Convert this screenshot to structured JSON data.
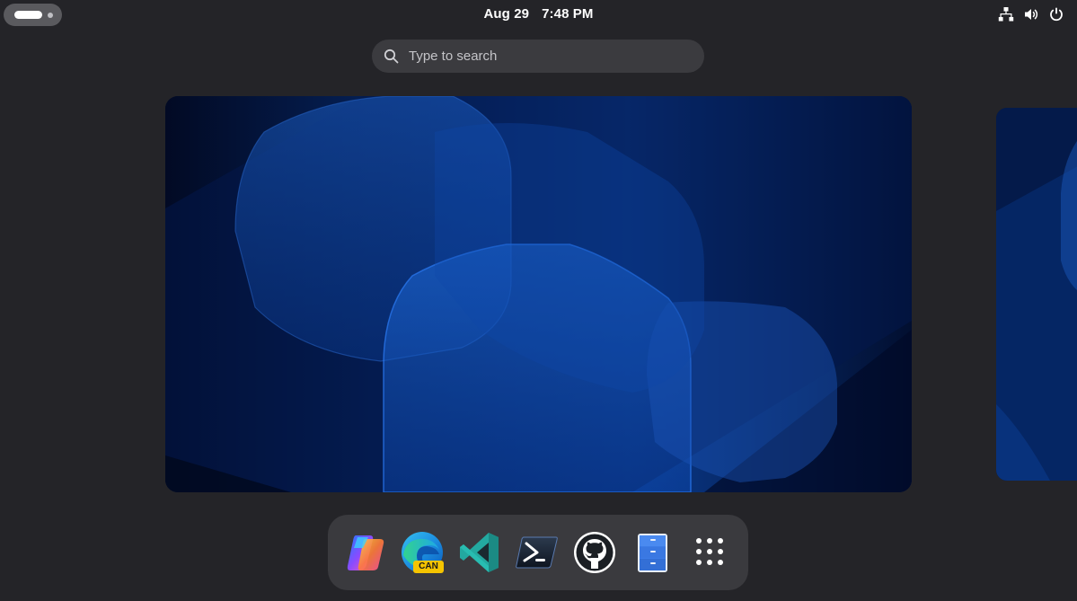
{
  "topbar": {
    "date": "Aug 29",
    "time": "7:48 PM",
    "tray_icons": [
      "network-icon",
      "volume-icon",
      "power-icon"
    ]
  },
  "search": {
    "placeholder": "Type to search"
  },
  "dash": {
    "items": [
      {
        "name": "copilot",
        "icon": "copilot-icon"
      },
      {
        "name": "edge-canary",
        "icon": "edge-icon",
        "badge": "CAN"
      },
      {
        "name": "vscode",
        "icon": "vscode-icon"
      },
      {
        "name": "powershell",
        "icon": "powershell-icon"
      },
      {
        "name": "github",
        "icon": "github-icon"
      },
      {
        "name": "files",
        "icon": "file-cabinet-icon"
      },
      {
        "name": "show-apps",
        "icon": "app-grid-icon"
      }
    ]
  },
  "colors": {
    "background": "#242428",
    "panel": "#3a3a3e",
    "search_bg": "#3b3b3f",
    "wallpaper_blue": "#0a3a8a"
  }
}
